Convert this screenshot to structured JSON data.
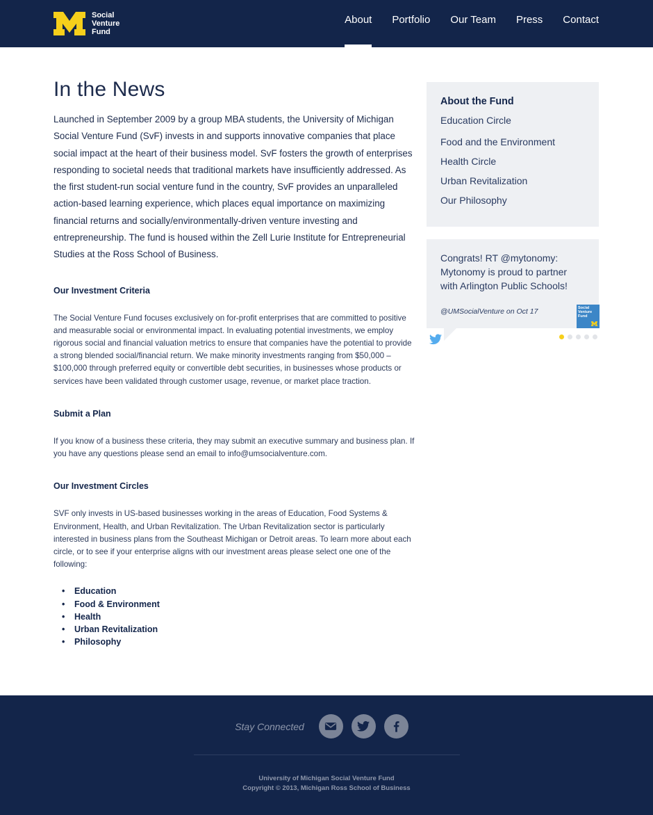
{
  "brand": {
    "logo_text_line1": "Social",
    "logo_text_line2": "Venture",
    "logo_text_line3": "Fund",
    "colors": {
      "navy": "#13254a",
      "maize": "#f6cf1b",
      "light_panel": "#eef0f3",
      "twitter_blue": "#55acee"
    }
  },
  "nav": {
    "items": [
      {
        "label": "About",
        "active": true
      },
      {
        "label": "Portfolio",
        "active": false
      },
      {
        "label": "Our Team",
        "active": false
      },
      {
        "label": "Press",
        "active": false
      },
      {
        "label": "Contact",
        "active": false
      }
    ]
  },
  "main": {
    "title": "In the News",
    "intro": "Launched in September 2009 by a group MBA students, the University of Michigan Social Venture Fund (SvF) invests in and supports innovative companies that place social impact at the heart of their business model. SvF fosters the growth of enterprises responding to societal needs that traditional markets have insufficiently addressed. As the first student-run social venture fund in the country, SvF provides an unparalleled action-based learning experience, which places equal importance on maximizing financial returns and socially/environmentally-driven venture investing and entrepreneurship. The fund is housed within the Zell Lurie Institute for Entrepreneurial Studies at the Ross School of Business.",
    "sections": [
      {
        "title": "Our Investment Criteria",
        "body": "The Social Venture Fund focuses exclusively on for-profit enterprises that are committed to positive and measurable social or environmental impact. In evaluating potential investments, we employ rigorous social and financial valuation metrics to ensure that companies have the potential to provide a strong blended social/financial return. We make minority investments ranging from $50,000 – $100,000 through preferred equity or convertible debt securities, in businesses whose products or services have been validated through customer usage, revenue, or market place traction."
      },
      {
        "title": "Submit a Plan",
        "body": "If you know of a business these criteria, they may submit an executive summary and business plan. If you have any questions please send an email to info@umsocialventure.com."
      },
      {
        "title": "Our Investment Circles",
        "body": "SVF only invests in US-based businesses working in the areas of Education, Food Systems & Environment, Health, and Urban Revitalization. The Urban Revitalization sector is particularly interested in business plans from the Southeast Michigan or Detroit areas. To learn more about each circle, or to see if your enterprise aligns with our investment areas please select one one of the following:"
      }
    ],
    "circles": [
      "Education",
      "Food & Environment",
      "Health",
      "Urban Revitalization",
      "Philosophy"
    ]
  },
  "sidebar": {
    "heading": "About the Fund",
    "links": [
      "Education Circle",
      "Food and the Environment",
      "Health Circle",
      "Urban Revitalization",
      "Our Philosophy"
    ]
  },
  "tweet": {
    "text": "Congrats! RT @mytonomy: Mytonomy is proud to partner with Arlington Public Schools!",
    "meta": "@UMSocialVenture on Oct 17",
    "avatar_line1": "Social",
    "avatar_line2": "Venture",
    "avatar_line3": "Fund",
    "active_slide": 1,
    "slide_count": 5
  },
  "footer": {
    "stay_connected": "Stay Connected",
    "social_icons": [
      "email-icon",
      "twitter-icon",
      "facebook-icon"
    ],
    "line1": "University of Michigan Social Venture Fund",
    "line2": "Copyright © 2013, Michigan Ross School of Business"
  }
}
